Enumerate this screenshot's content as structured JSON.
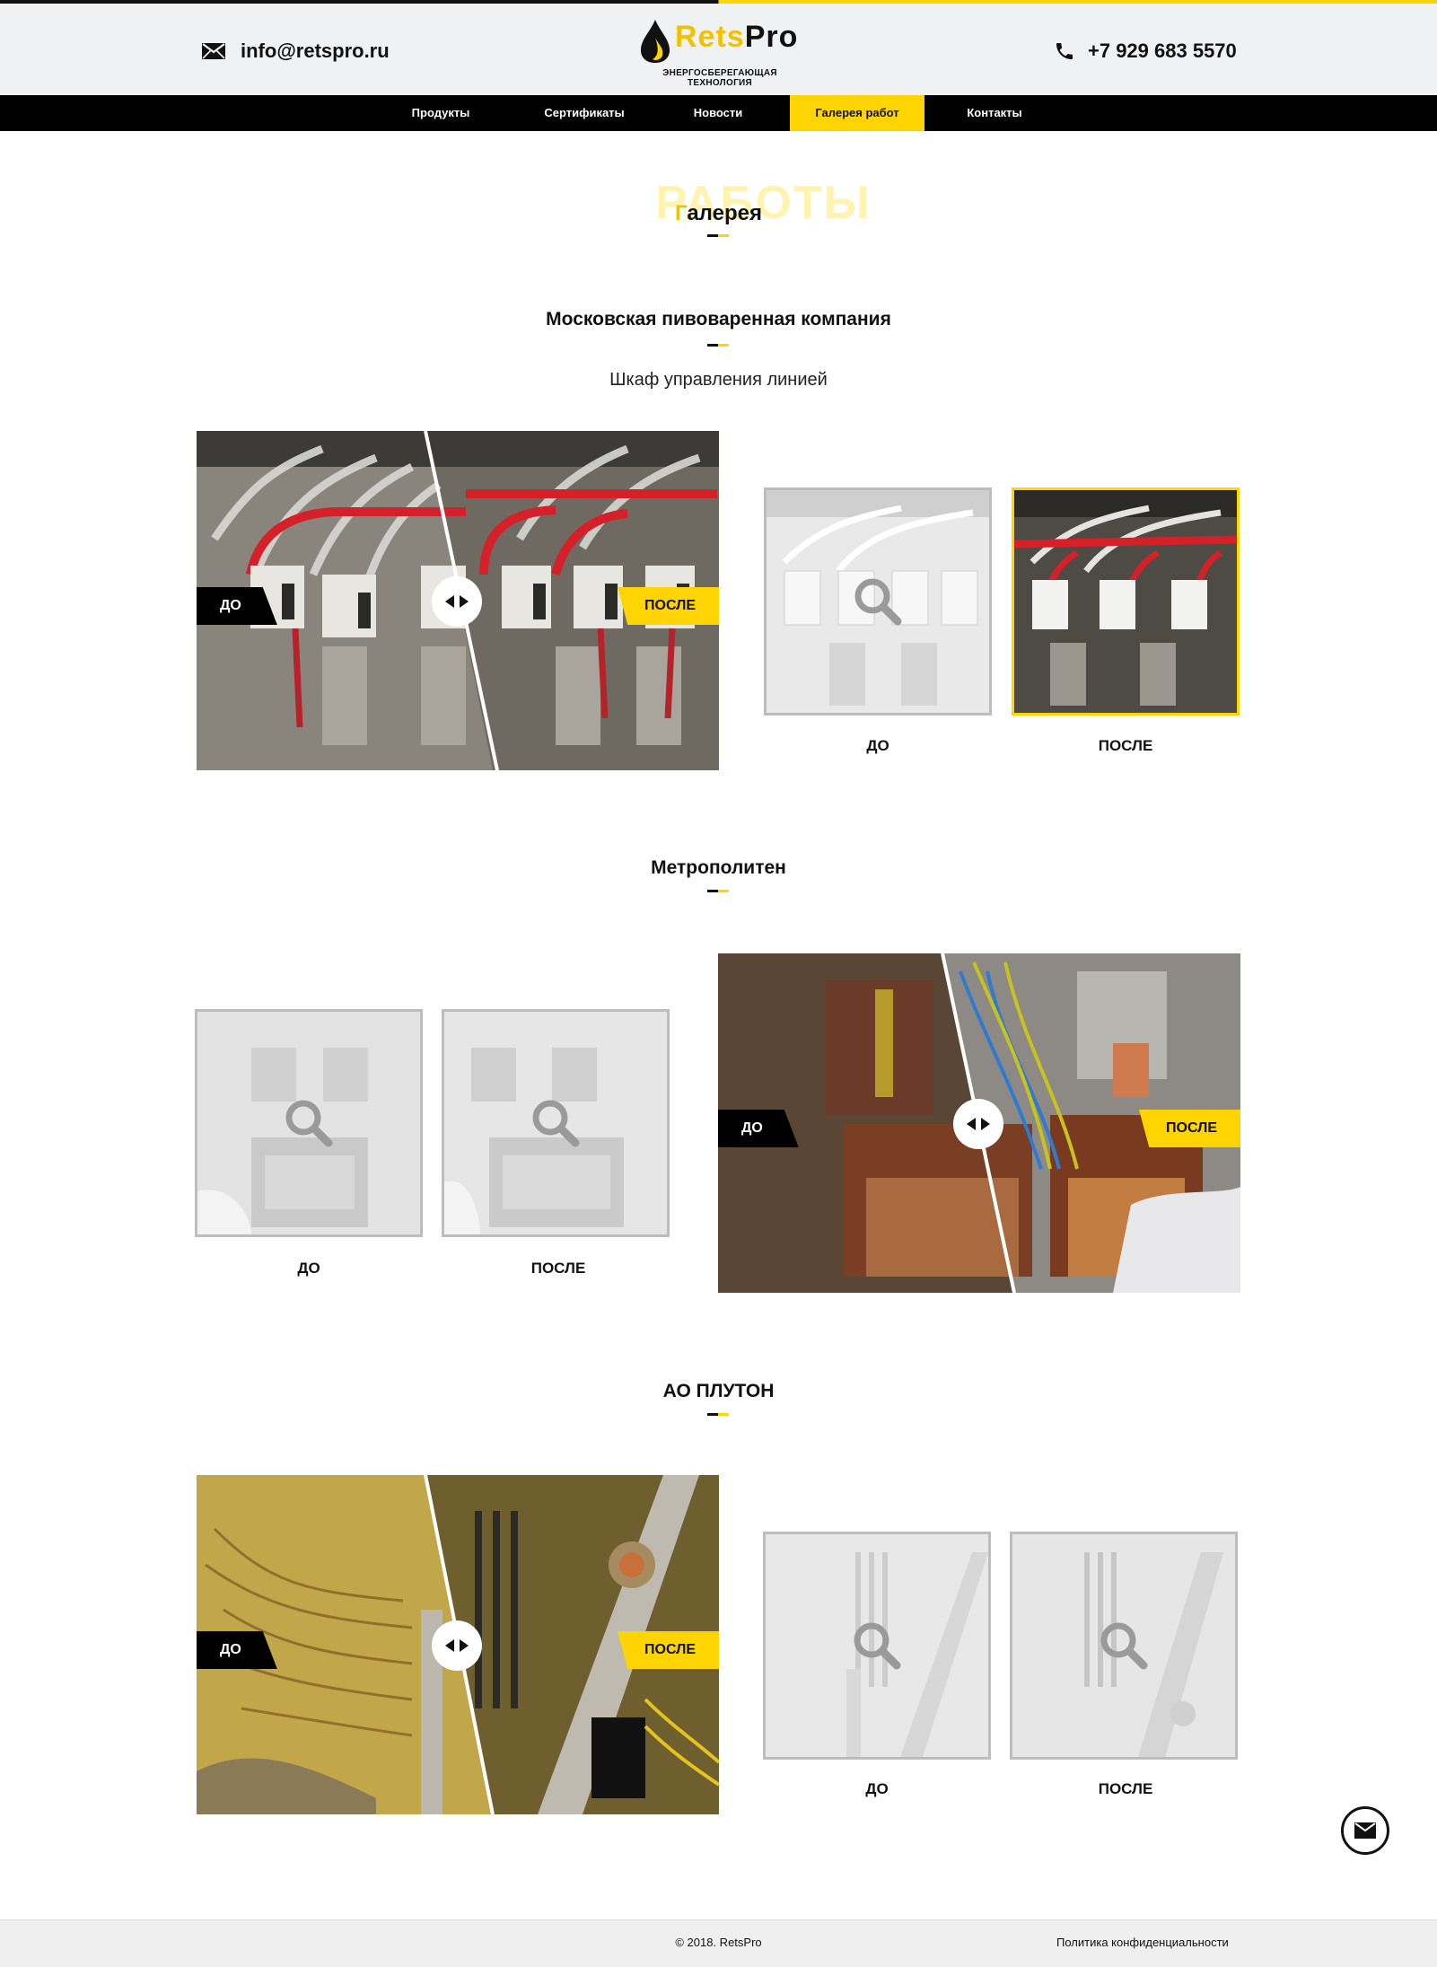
{
  "header": {
    "email": "info@retspro.ru",
    "phone": "+7 929 683 5570",
    "logo": {
      "brand_a": "Rets",
      "brand_b": "Pro",
      "tagline": "ЭНЕРГОСБЕРЕГАЮЩАЯ ТЕХНОЛОГИЯ"
    }
  },
  "nav": {
    "items": [
      {
        "label": "Продукты"
      },
      {
        "label": "Сертификаты"
      },
      {
        "label": "Новости"
      },
      {
        "label": "Галерея работ",
        "active": true
      },
      {
        "label": "Контакты"
      }
    ]
  },
  "page": {
    "watermark": "РАБОТЫ",
    "title_first": "Г",
    "title_rest": "алерея"
  },
  "sections": [
    {
      "title": "Московская пивоваренная компания",
      "subtitle": "Шкаф управления линией",
      "before_label": "ДО",
      "after_label": "ПОСЛЕ",
      "thumbs": [
        {
          "label": "ДО"
        },
        {
          "label": "ПОСЛЕ",
          "selected": true
        }
      ]
    },
    {
      "title": "Метрополитен",
      "before_label": "ДО",
      "after_label": "ПОСЛЕ",
      "thumbs": [
        {
          "label": "ДО"
        },
        {
          "label": "ПОСЛЕ"
        }
      ]
    },
    {
      "title": "АО ПЛУТОН",
      "before_label": "ДО",
      "after_label": "ПОСЛЕ",
      "thumbs": [
        {
          "label": "ДО"
        },
        {
          "label": "ПОСЛЕ"
        }
      ]
    }
  ],
  "footer": {
    "copyright": "© 2018. RetsPro",
    "policy": "Политика конфиденциальности"
  },
  "colors": {
    "accent": "#ffd400",
    "dark": "#000000",
    "header_bg": "#f0f1f3"
  },
  "icons": {
    "email": "envelope-icon",
    "phone": "phone-icon",
    "zoom": "magnifier-icon",
    "slider": "left-right-arrows-icon",
    "fab": "mail-icon"
  }
}
